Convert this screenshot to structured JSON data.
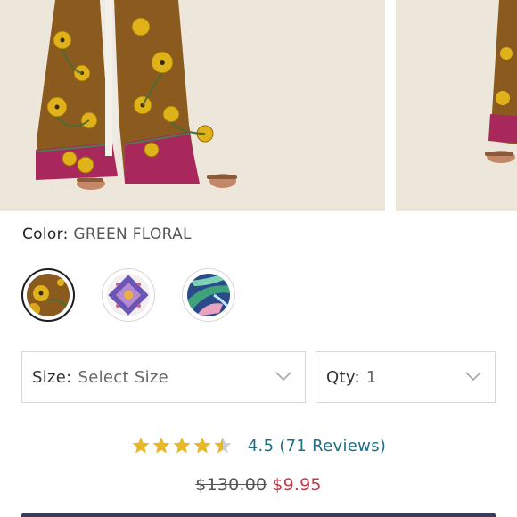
{
  "product": {
    "images": [
      {
        "name": "product-image-main"
      },
      {
        "name": "product-image-next"
      }
    ],
    "color": {
      "label": "Color:",
      "value": "GREEN FLORAL",
      "swatches": [
        {
          "name": "green-floral",
          "selected": true
        },
        {
          "name": "purple-tile",
          "selected": false
        },
        {
          "name": "blue-leaf",
          "selected": false
        }
      ]
    },
    "size": {
      "label": "Size:",
      "value": "Select Size"
    },
    "qty": {
      "label": "Qty:",
      "value": "1"
    },
    "rating": {
      "score": "4.5",
      "reviews": "(71 Reviews)",
      "stars_value": 4.5,
      "stars_max": 5,
      "star_color": "#e8b827"
    },
    "price": {
      "original": "$130.00",
      "sale": "$9.95",
      "sale_color": "#c4394c"
    }
  }
}
